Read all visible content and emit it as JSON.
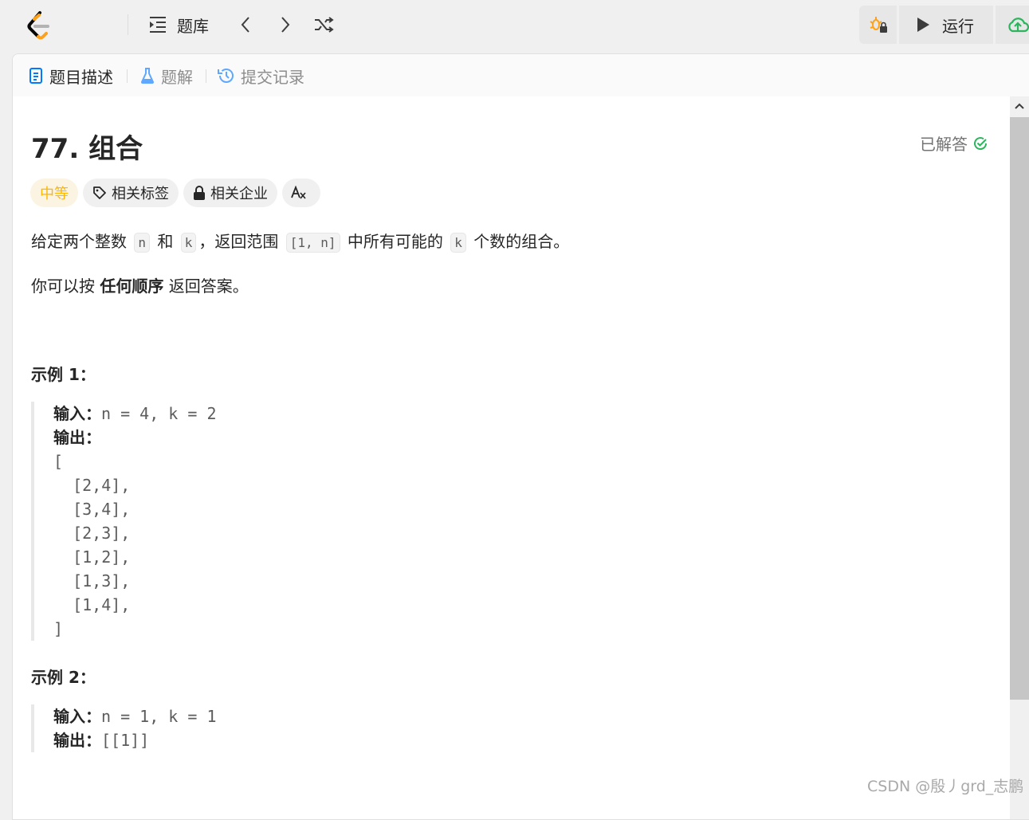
{
  "topbar": {
    "problem_list_label": "题库",
    "run_label": "运行"
  },
  "tabs": {
    "description": "题目描述",
    "solutions": "题解",
    "submissions": "提交记录"
  },
  "problem": {
    "title": "77. 组合",
    "solved_status": "已解答",
    "difficulty": "中等",
    "tag_related_topics": "相关标签",
    "tag_related_companies": "相关企业",
    "p1_a": "给定两个整数",
    "p1_n": "n",
    "p1_b": "和",
    "p1_k": "k",
    "p1_c": "，返回范围",
    "p1_range": "[1, n]",
    "p1_d": "中所有可能的",
    "p1_k2": "k",
    "p1_e": "个数的组合。",
    "p2_a": "你可以按",
    "p2_bold": "任何顺序",
    "p2_b": "返回答案。"
  },
  "examples": [
    {
      "heading": "示例 1：",
      "input_label": "输入：",
      "input_value": "n = 4, k = 2",
      "output_label": "输出：",
      "output_lines": [
        "[",
        "  [2,4],",
        "  [3,4],",
        "  [2,3],",
        "  [1,2],",
        "  [1,3],",
        "  [1,4],",
        "]"
      ]
    },
    {
      "heading": "示例 2：",
      "input_label": "输入：",
      "input_value": "n = 1, k = 1",
      "output_label": "输出：",
      "output_value": "[[1]]"
    }
  ],
  "watermark": "CSDN @殷丿grd_志鹏",
  "colors": {
    "difficulty_medium": "#ffb800",
    "solved_green": "#2db55d",
    "brand_orange": "#ffa116"
  }
}
